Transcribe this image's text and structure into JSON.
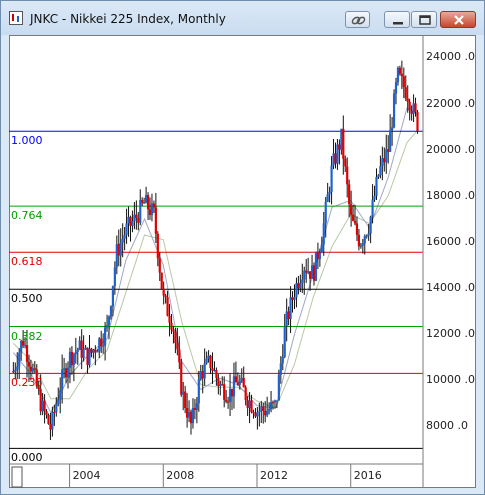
{
  "window": {
    "title": "JNKC - Nikkei 225 Index, Monthly"
  },
  "chart_data": {
    "type": "candlestick",
    "title": "JNKC - Nikkei 225 Index, Monthly",
    "ylim": [
      6500,
      24800
    ],
    "xlim": [
      2001.5,
      2019.0
    ],
    "y_ticks": [
      8000,
      10000,
      12000,
      14000,
      16000,
      18000,
      20000,
      22000,
      24000
    ],
    "y_tick_labels": [
      "8000 .0",
      "10000 .0",
      "12000 .0",
      "14000 .0",
      "16000 .0",
      "18000 .0",
      "20000 .0",
      "22000 .0",
      "24000 .0"
    ],
    "x_ticks": [
      2004,
      2008,
      2012,
      2016
    ],
    "x_tick_labels": [
      "2004",
      "2008",
      "2012",
      "2016"
    ],
    "fib_levels": [
      {
        "label": "1.000",
        "value": 20800,
        "color": "#0000ff"
      },
      {
        "label": "0.764",
        "value": 17550,
        "color": "#00a000"
      },
      {
        "label": "0.618",
        "value": 15550,
        "color": "#e00000"
      },
      {
        "label": "0.500",
        "value": 13950,
        "color": "#000000"
      },
      {
        "label": "0.382",
        "value": 12330,
        "color": "#00a000"
      },
      {
        "label": "0.236",
        "value": 10300,
        "color": "#e00000"
      },
      {
        "label": "0.000",
        "value": 7050,
        "color": "#000000"
      }
    ],
    "price_series": {
      "x": [
        2001.6,
        2002.0,
        2002.4,
        2002.8,
        2003.2,
        2003.6,
        2004.0,
        2004.4,
        2004.8,
        2005.2,
        2005.6,
        2006.0,
        2006.4,
        2006.8,
        2007.2,
        2007.6,
        2008.0,
        2008.4,
        2008.8,
        2009.2,
        2009.6,
        2010.0,
        2010.4,
        2010.8,
        2011.2,
        2011.6,
        2012.0,
        2012.4,
        2012.8,
        2013.2,
        2013.6,
        2014.0,
        2014.4,
        2014.8,
        2015.2,
        2015.6,
        2016.0,
        2016.4,
        2016.8,
        2017.2,
        2017.6,
        2018.0,
        2018.4,
        2018.9
      ],
      "y": [
        10400,
        11800,
        10500,
        8900,
        7900,
        9800,
        11000,
        11400,
        11000,
        11600,
        12200,
        15500,
        16500,
        17000,
        17700,
        17200,
        13500,
        12500,
        9500,
        8000,
        10300,
        10800,
        9800,
        9400,
        10000,
        9200,
        8700,
        8700,
        8900,
        12300,
        13900,
        15000,
        14600,
        16400,
        19200,
        20500,
        17000,
        16000,
        16800,
        19000,
        20000,
        23200,
        22500,
        21000
      ]
    },
    "ma_fast": {
      "x": [
        2001.6,
        2002.4,
        2003.2,
        2004.0,
        2004.8,
        2005.6,
        2006.4,
        2007.2,
        2008.0,
        2008.8,
        2009.6,
        2010.4,
        2011.2,
        2012.0,
        2012.8,
        2013.6,
        2014.4,
        2015.2,
        2016.0,
        2016.8,
        2017.6,
        2018.4,
        2018.9
      ],
      "y": [
        11200,
        10200,
        8600,
        10200,
        11100,
        11800,
        15200,
        17000,
        15000,
        10800,
        9600,
        10100,
        9800,
        8900,
        8800,
        12000,
        14600,
        17500,
        17800,
        16600,
        18800,
        21800,
        21500
      ]
    },
    "ma_slow": {
      "x": [
        2001.6,
        2002.4,
        2003.2,
        2004.0,
        2004.8,
        2005.6,
        2006.4,
        2007.2,
        2008.0,
        2008.8,
        2009.6,
        2010.4,
        2011.2,
        2012.0,
        2012.8,
        2013.6,
        2014.4,
        2015.2,
        2016.0,
        2016.8,
        2017.6,
        2018.4,
        2018.9
      ],
      "y": [
        11600,
        10800,
        9200,
        9200,
        10500,
        11300,
        13800,
        16300,
        16100,
        12500,
        9800,
        9700,
        9700,
        9100,
        8800,
        10700,
        13600,
        15800,
        17200,
        16800,
        18000,
        20300,
        20900
      ]
    }
  }
}
